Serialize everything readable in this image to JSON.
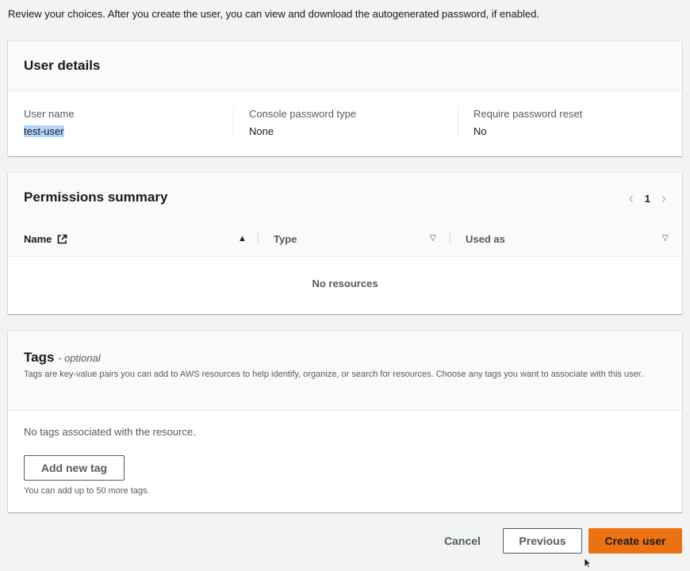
{
  "intro_text": "Review your choices. After you create the user, you can view and download the autogenerated password, if enabled.",
  "user_details": {
    "title": "User details",
    "fields": [
      {
        "label": "User name",
        "value": "test-user"
      },
      {
        "label": "Console password type",
        "value": "None"
      },
      {
        "label": "Require password reset",
        "value": "No"
      }
    ]
  },
  "permissions": {
    "title": "Permissions summary",
    "pagination": {
      "current_page": "1"
    },
    "columns": [
      "Name",
      "Type",
      "Used as"
    ],
    "empty_text": "No resources"
  },
  "tags": {
    "title": "Tags",
    "optional": "- optional",
    "description": "Tags are key-value pairs you can add to AWS resources to help identify, organize, or search for resources. Choose any tags you want to associate with this user.",
    "empty_text": "No tags associated with the resource.",
    "add_button": "Add new tag",
    "limit_text": "You can add up to 50 more tags."
  },
  "footer": {
    "cancel": "Cancel",
    "previous": "Previous",
    "create": "Create user"
  },
  "colors": {
    "primary_button": "#ec7211",
    "selection_highlight": "#b4d5fe"
  },
  "icons": {
    "external_link": "external-link-icon",
    "sort_asc": "caret-up-icon",
    "sort": "caret-down-icon",
    "prev": "chevron-left-icon",
    "next": "chevron-right-icon"
  }
}
